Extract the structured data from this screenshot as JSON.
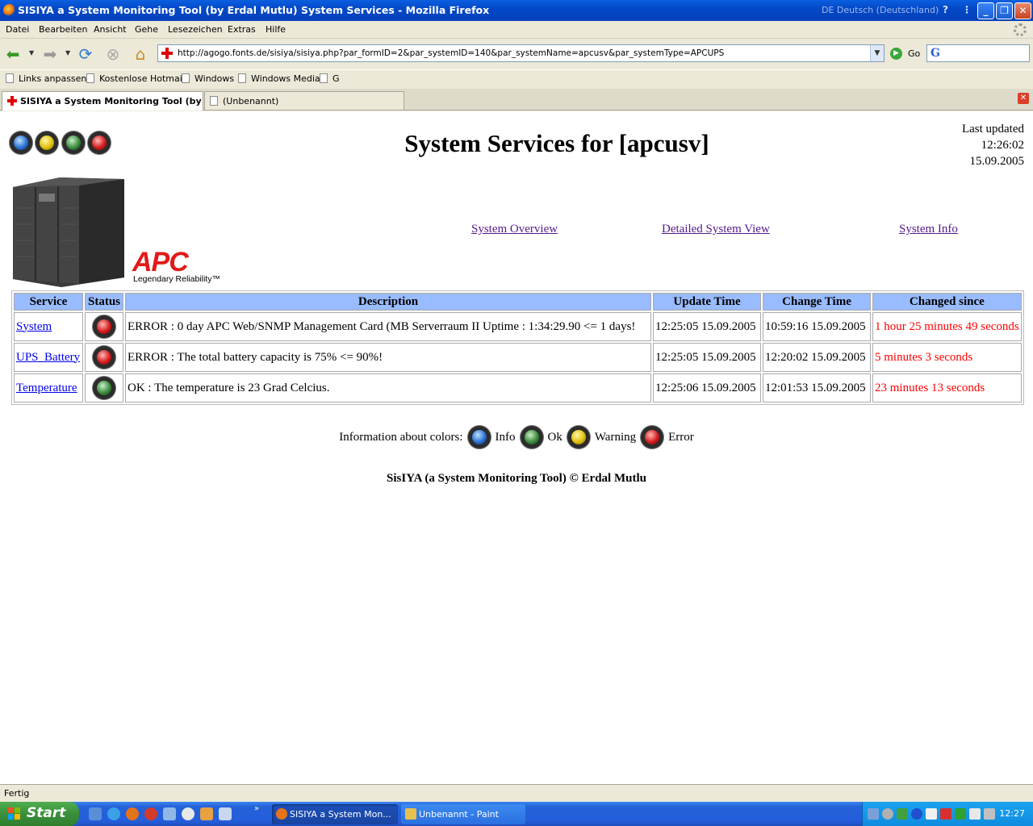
{
  "window": {
    "title": "SISIYA a System Monitoring Tool (by Erdal Mutlu) System Services - Mozilla Firefox",
    "language": "DE Deutsch (Deutschland)"
  },
  "menu": [
    "Datei",
    "Bearbeiten",
    "Ansicht",
    "Gehe",
    "Lesezeichen",
    "Extras",
    "Hilfe"
  ],
  "navbar": {
    "url": "http://agogo.fonts.de/sisiya/sisiya.php?par_formID=2&par_systemID=140&par_systemName=apcusv&par_systemType=APCUPS",
    "go_label": "Go",
    "search_logo": "G"
  },
  "bookmarks": [
    "Links anpassen",
    "Kostenlose Hotmail",
    "Windows",
    "Windows Media",
    "G"
  ],
  "tabs": [
    {
      "label": "SISIYA a System Monitoring Tool (by ...",
      "active": true
    },
    {
      "label": "(Unbenannt)",
      "active": false
    }
  ],
  "page": {
    "title": "System Services for [apcusv]",
    "last_updated": {
      "label": "Last updated",
      "time": "12:26:02",
      "date": "15.09.2005"
    },
    "logo": {
      "brand": "APC",
      "tagline": "Legendary Reliability™"
    },
    "nav_links": [
      "System Overview",
      "Detailed System View",
      "System Info"
    ],
    "table": {
      "headers": [
        "Service",
        "Status",
        "Description",
        "Update Time",
        "Change Time",
        "Changed since"
      ],
      "rows": [
        {
          "service": "System",
          "status": "error",
          "description": "ERROR : 0 day APC Web/SNMP Management Card (MB Serverraum II Uptime : 1:34:29.90 <= 1 days!",
          "update_time": "12:25:05 15.09.2005",
          "change_time": "10:59:16 15.09.2005",
          "changed_since": "1 hour 25 minutes 49 seconds"
        },
        {
          "service": "UPS_Battery",
          "status": "error",
          "description": "ERROR : The total battery capacity is 75% <= 90%!",
          "update_time": "12:25:05 15.09.2005",
          "change_time": "12:20:02 15.09.2005",
          "changed_since": "5 minutes 3 seconds"
        },
        {
          "service": "Temperature",
          "status": "ok",
          "description": "OK : The temperature is 23 Grad Celcius.",
          "update_time": "12:25:06 15.09.2005",
          "change_time": "12:01:53 15.09.2005",
          "changed_since": "23 minutes 13 seconds"
        }
      ]
    },
    "legend": {
      "label": "Information about colors:",
      "items": [
        {
          "name": "Info",
          "color": "blue"
        },
        {
          "name": "Ok",
          "color": "green"
        },
        {
          "name": "Warning",
          "color": "yellow"
        },
        {
          "name": "Error",
          "color": "red"
        }
      ]
    },
    "footer": "SisIYA (a System Monitoring Tool) © Erdal Mutlu"
  },
  "status_bar": "Fertig",
  "taskbar": {
    "start": "Start",
    "tasks": [
      "SISIYA a System Mon...",
      "Unbenannt - Paint"
    ],
    "clock": "12:27"
  },
  "colors": {
    "header_bg": "#99bbff",
    "changed_since": "#ff0000",
    "link": "#0000ee",
    "visited_link": "#551a8b",
    "apc_red": "#e21a1a"
  }
}
